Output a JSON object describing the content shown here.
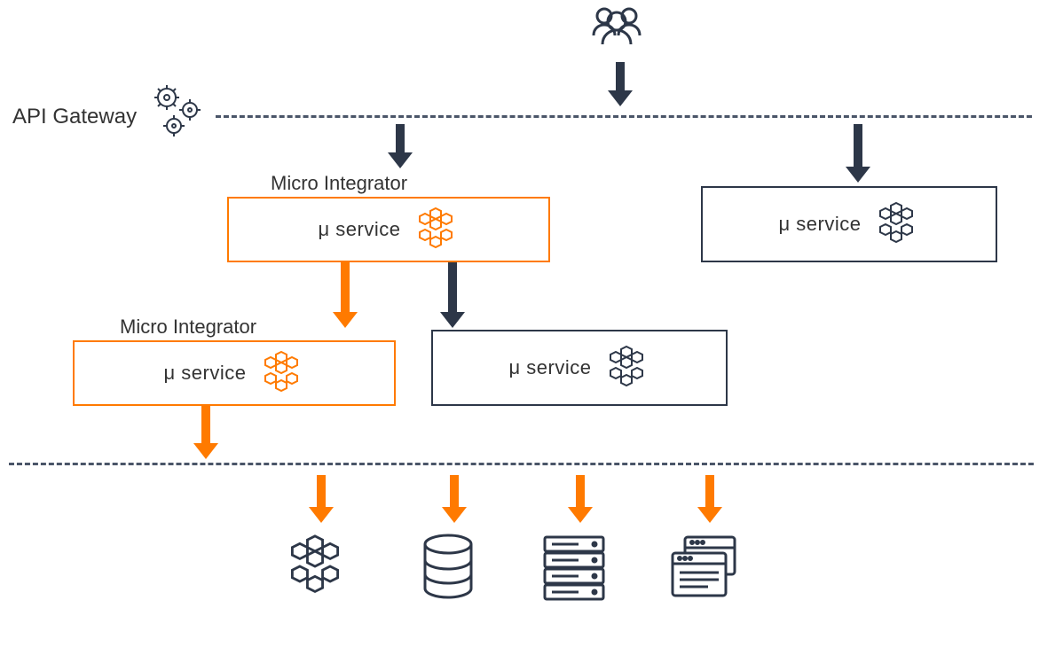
{
  "labels": {
    "api_gateway": "API Gateway",
    "micro_integrator": "Micro Integrator",
    "mu_service": "μ service"
  },
  "colors": {
    "accent_orange": "#ff7a00",
    "dark_gray": "#2d3748",
    "dash_gray": "#4a5568"
  },
  "icons": {
    "users": "users-icon",
    "gears": "gears-icon",
    "cluster_orange": "cube-cluster-icon",
    "cluster_dark": "cube-cluster-icon",
    "database": "database-icon",
    "server_rack": "server-rack-icon",
    "windows": "windows-icon"
  },
  "boxes": {
    "top_orange": {
      "title": "Micro Integrator",
      "label": "μ service",
      "variant": "orange"
    },
    "top_dark": {
      "label": "μ service",
      "variant": "dark"
    },
    "mid_orange": {
      "title": "Micro Integrator",
      "label": "μ service",
      "variant": "orange"
    },
    "mid_dark": {
      "label": "μ service",
      "variant": "dark"
    }
  }
}
